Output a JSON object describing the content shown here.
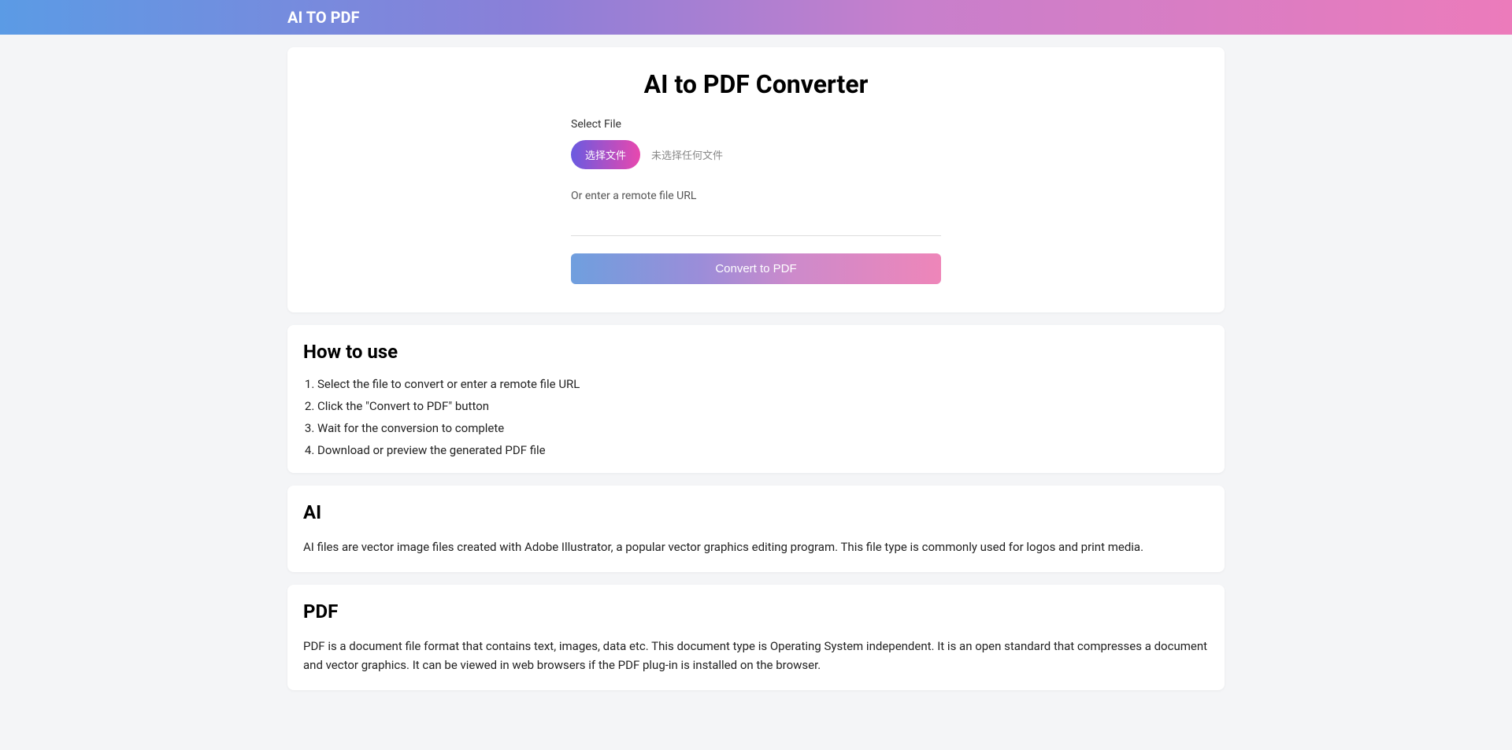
{
  "header": {
    "brand": "AI TO PDF"
  },
  "converter": {
    "title": "AI to PDF Converter",
    "select_file_label": "Select File",
    "file_button_label": "选择文件",
    "file_status": "未选择任何文件",
    "or_label": "Or enter a remote file URL",
    "url_value": "",
    "convert_button_label": "Convert to PDF"
  },
  "howto": {
    "title": "How to use",
    "steps": [
      "Select the file to convert or enter a remote file URL",
      "Click the \"Convert to PDF\" button",
      "Wait for the conversion to complete",
      "Download or preview the generated PDF file"
    ]
  },
  "ai_section": {
    "title": "AI",
    "desc": "AI files are vector image files created with Adobe Illustrator, a popular vector graphics editing program. This file type is commonly used for logos and print media."
  },
  "pdf_section": {
    "title": "PDF",
    "desc": "PDF is a document file format that contains text, images, data etc. This document type is Operating System independent. It is an open standard that compresses a document and vector graphics. It can be viewed in web browsers if the PDF plug-in is installed on the browser."
  }
}
